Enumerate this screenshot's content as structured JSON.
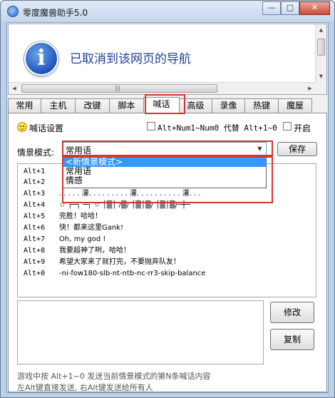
{
  "window": {
    "title": "零度魔兽助手5.0",
    "min_label": "—",
    "max_label": "□",
    "close_label": "✕"
  },
  "browser": {
    "message": "已取消到该网页的导航",
    "info_glyph": "i",
    "scroll_grip": "|||"
  },
  "tabs": [
    {
      "label": "常用",
      "active": false
    },
    {
      "label": "主机",
      "active": false
    },
    {
      "label": "改键",
      "active": false
    },
    {
      "label": "脚本",
      "active": false
    },
    {
      "label": "喊话",
      "active": true
    },
    {
      "label": "高级",
      "active": false
    },
    {
      "label": "录像",
      "active": false
    },
    {
      "label": "热键",
      "active": false
    },
    {
      "label": "魔屋",
      "active": false
    }
  ],
  "shout": {
    "section_title": "喊话设置",
    "replace_option": "Alt+Num1~Num0 代替 Alt+1~0",
    "enable_option": "开启",
    "scene_label": "情景模式:",
    "scene_selected": "常用语",
    "scene_options": [
      "<新情景模式>",
      "常用语",
      "情感"
    ],
    "save_label": "保存",
    "messages": [
      {
        "key": "Alt+1",
        "text": ""
      },
      {
        "key": "Alt+2",
        "text": ""
      },
      {
        "key": "Alt+3",
        "text": ". . . . . 灌. . . . . . . . . 灌. . . . . . . . . . 灌. . ."
      },
      {
        "key": "Alt+4",
        "text": "☆ ┌─┐  ─┐ ☆  │▒│ /▒/  │▒│▒/  │▒│▒/─┼─"
      },
      {
        "key": "Alt+5",
        "text": "完胜！哈哈！"
      },
      {
        "key": "Alt+6",
        "text": "快！都来这里Gank!"
      },
      {
        "key": "Alt+7",
        "text": "Oh, my god !"
      },
      {
        "key": "Alt+8",
        "text": "我要超神了咧，哈哈！"
      },
      {
        "key": "Alt+9",
        "text": "希望大家来了就打完，不要抛弃队友！"
      },
      {
        "key": "Alt+0",
        "text": "-ni-fow180-slb-nt-ntb-nc-rr3-skip-balance"
      }
    ],
    "modify_label": "修改",
    "copy_label": "复制",
    "footer_line1": "游戏中按 Alt+1~0 发送当前情景模式的第N条喊话内容",
    "footer_line2": "左Alt键直接发送, 右Alt键发送给所有人"
  },
  "colors": {
    "highlight": "#d8342f",
    "link_blue": "#1f3f9b",
    "selection": "#3399ff"
  }
}
